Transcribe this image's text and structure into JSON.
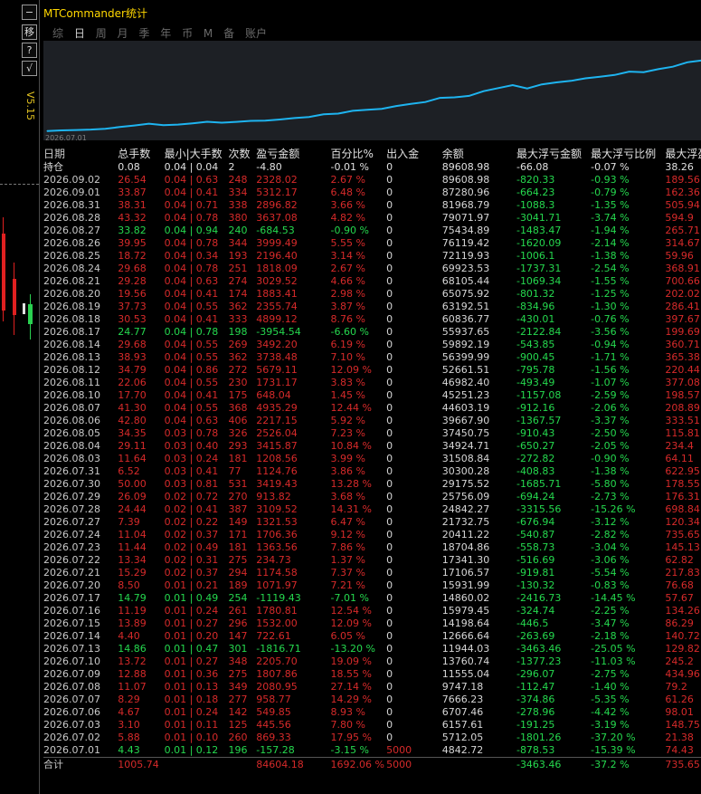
{
  "window": {
    "title": "MTCommander统计",
    "version": "V5.15"
  },
  "side_buttons": [
    "−",
    "移",
    "?",
    "√"
  ],
  "tabs": [
    {
      "label": "综",
      "active": false
    },
    {
      "label": "日",
      "active": true
    },
    {
      "label": "周",
      "active": false
    },
    {
      "label": "月",
      "active": false
    },
    {
      "label": "季",
      "active": false
    },
    {
      "label": "年",
      "active": false
    },
    {
      "label": "币",
      "active": false
    },
    {
      "label": "M",
      "active": false
    },
    {
      "label": "备",
      "active": false
    },
    {
      "label": "账户",
      "active": false
    }
  ],
  "chart_data": {
    "type": "line",
    "x_tick": "2026.07.01",
    "series_color": "#1eb4f0",
    "x": [
      "2026.07.01",
      "2026.07.02",
      "2026.07.03",
      "2026.07.06",
      "2026.07.07",
      "2026.07.08",
      "2026.07.09",
      "2026.07.10",
      "2026.07.13",
      "2026.07.14",
      "2026.07.15",
      "2026.07.16",
      "2026.07.17",
      "2026.07.20",
      "2026.07.21",
      "2026.07.22",
      "2026.07.23",
      "2026.07.24",
      "2026.07.27",
      "2026.07.28",
      "2026.07.29",
      "2026.07.30",
      "2026.07.31",
      "2026.08.03",
      "2026.08.04",
      "2026.08.05",
      "2026.08.06",
      "2026.08.07",
      "2026.08.10",
      "2026.08.11",
      "2026.08.12",
      "2026.08.13",
      "2026.08.14",
      "2026.08.17",
      "2026.08.18",
      "2026.08.19",
      "2026.08.20",
      "2026.08.21",
      "2026.08.24",
      "2026.08.25",
      "2026.08.26",
      "2026.08.27",
      "2026.08.28",
      "2026.08.31",
      "2026.09.01",
      "2026.09.02"
    ],
    "values": [
      4842.72,
      5712.05,
      6157.61,
      6707.46,
      7666.23,
      9747.18,
      11555.04,
      13760.74,
      11944.03,
      12666.64,
      14198.64,
      15979.45,
      14860.02,
      15931.99,
      17106.57,
      17341.3,
      18704.86,
      20411.22,
      21732.75,
      24842.27,
      25756.09,
      29175.52,
      30300.28,
      31508.84,
      34924.71,
      37450.75,
      39667.9,
      44603.19,
      45251.23,
      46982.4,
      52661.51,
      56399.99,
      59892.19,
      55937.65,
      60836.77,
      63192.51,
      65075.92,
      68105.44,
      69923.53,
      72119.93,
      76119.42,
      75434.89,
      79071.97,
      81968.79,
      87280.96,
      89608.98
    ]
  },
  "table": {
    "headers": [
      "日期",
      "总手数",
      "最小|大手数",
      "次数",
      "盈亏金额",
      "百分比%",
      "出入金",
      "余额",
      "最大浮亏金额",
      "最大浮亏比例",
      "最大浮盈金"
    ],
    "rows": [
      {
        "t": "hold",
        "c": [
          "持仓",
          "0.08",
          "0.04 | 0.04",
          "2",
          "-4.80",
          "-0.01 %",
          "0",
          "89608.98",
          "-66.08",
          "-0.07 %",
          "38.26"
        ]
      },
      {
        "t": "pos",
        "c": [
          "2026.09.02",
          "26.54",
          "0.04 | 0.63",
          "248",
          "2328.02",
          "2.67 %",
          "0",
          "89608.98",
          "-820.33",
          "-0.93 %",
          "189.56"
        ]
      },
      {
        "t": "pos",
        "c": [
          "2026.09.01",
          "33.87",
          "0.04 | 0.41",
          "334",
          "5312.17",
          "6.48 %",
          "0",
          "87280.96",
          "-664.23",
          "-0.79 %",
          "162.36"
        ]
      },
      {
        "t": "pos",
        "c": [
          "2026.08.31",
          "38.31",
          "0.04 | 0.71",
          "338",
          "2896.82",
          "3.66 %",
          "0",
          "81968.79",
          "-1088.3",
          "-1.35 %",
          "505.94"
        ]
      },
      {
        "t": "pos",
        "c": [
          "2026.08.28",
          "43.32",
          "0.04 | 0.78",
          "380",
          "3637.08",
          "4.82 %",
          "0",
          "79071.97",
          "-3041.71",
          "-3.74 %",
          "594.9"
        ]
      },
      {
        "t": "neg",
        "c": [
          "2026.08.27",
          "33.82",
          "0.04 | 0.94",
          "240",
          "-684.53",
          "-0.90 %",
          "0",
          "75434.89",
          "-1483.47",
          "-1.94 %",
          "265.71"
        ]
      },
      {
        "t": "pos",
        "c": [
          "2026.08.26",
          "39.95",
          "0.04 | 0.78",
          "344",
          "3999.49",
          "5.55 %",
          "0",
          "76119.42",
          "-1620.09",
          "-2.14 %",
          "314.67"
        ]
      },
      {
        "t": "pos",
        "c": [
          "2026.08.25",
          "18.72",
          "0.04 | 0.34",
          "193",
          "2196.40",
          "3.14 %",
          "0",
          "72119.93",
          "-1006.1",
          "-1.38 %",
          "59.96"
        ]
      },
      {
        "t": "pos",
        "c": [
          "2026.08.24",
          "29.68",
          "0.04 | 0.78",
          "251",
          "1818.09",
          "2.67 %",
          "0",
          "69923.53",
          "-1737.31",
          "-2.54 %",
          "368.91"
        ]
      },
      {
        "t": "pos",
        "c": [
          "2026.08.21",
          "29.28",
          "0.04 | 0.63",
          "274",
          "3029.52",
          "4.66 %",
          "0",
          "68105.44",
          "-1069.34",
          "-1.55 %",
          "700.66"
        ]
      },
      {
        "t": "pos",
        "c": [
          "2026.08.20",
          "19.56",
          "0.04 | 0.41",
          "174",
          "1883.41",
          "2.98 %",
          "0",
          "65075.92",
          "-801.32",
          "-1.25 %",
          "202.02"
        ]
      },
      {
        "t": "pos",
        "c": [
          "2026.08.19",
          "37.73",
          "0.04 | 0.55",
          "362",
          "2355.74",
          "3.87 %",
          "0",
          "63192.51",
          "-834.96",
          "-1.30 %",
          "286.41"
        ]
      },
      {
        "t": "pos",
        "c": [
          "2026.08.18",
          "30.53",
          "0.04 | 0.41",
          "333",
          "4899.12",
          "8.76 %",
          "0",
          "60836.77",
          "-430.01",
          "-0.76 %",
          "397.67"
        ]
      },
      {
        "t": "neg",
        "c": [
          "2026.08.17",
          "24.77",
          "0.04 | 0.78",
          "198",
          "-3954.54",
          "-6.60 %",
          "0",
          "55937.65",
          "-2122.84",
          "-3.56 %",
          "199.69"
        ]
      },
      {
        "t": "pos",
        "c": [
          "2026.08.14",
          "29.68",
          "0.04 | 0.55",
          "269",
          "3492.20",
          "6.19 %",
          "0",
          "59892.19",
          "-543.85",
          "-0.94 %",
          "360.71"
        ]
      },
      {
        "t": "pos",
        "c": [
          "2026.08.13",
          "38.93",
          "0.04 | 0.55",
          "362",
          "3738.48",
          "7.10 %",
          "0",
          "56399.99",
          "-900.45",
          "-1.71 %",
          "365.38"
        ]
      },
      {
        "t": "pos",
        "c": [
          "2026.08.12",
          "34.79",
          "0.04 | 0.86",
          "272",
          "5679.11",
          "12.09 %",
          "0",
          "52661.51",
          "-795.78",
          "-1.56 %",
          "220.44"
        ]
      },
      {
        "t": "pos",
        "c": [
          "2026.08.11",
          "22.06",
          "0.04 | 0.55",
          "230",
          "1731.17",
          "3.83 %",
          "0",
          "46982.40",
          "-493.49",
          "-1.07 %",
          "377.08"
        ]
      },
      {
        "t": "pos",
        "c": [
          "2026.08.10",
          "17.70",
          "0.04 | 0.41",
          "175",
          "648.04",
          "1.45 %",
          "0",
          "45251.23",
          "-1157.08",
          "-2.59 %",
          "198.57"
        ]
      },
      {
        "t": "pos",
        "c": [
          "2026.08.07",
          "41.30",
          "0.04 | 0.55",
          "368",
          "4935.29",
          "12.44 %",
          "0",
          "44603.19",
          "-912.16",
          "-2.06 %",
          "208.89"
        ]
      },
      {
        "t": "pos",
        "c": [
          "2026.08.06",
          "42.80",
          "0.04 | 0.63",
          "406",
          "2217.15",
          "5.92 %",
          "0",
          "39667.90",
          "-1367.57",
          "-3.37 %",
          "333.51"
        ]
      },
      {
        "t": "pos",
        "c": [
          "2026.08.05",
          "34.35",
          "0.03 | 0.78",
          "326",
          "2526.04",
          "7.23 %",
          "0",
          "37450.75",
          "-910.43",
          "-2.50 %",
          "115.81"
        ]
      },
      {
        "t": "pos",
        "c": [
          "2026.08.04",
          "29.11",
          "0.03 | 0.40",
          "293",
          "3415.87",
          "10.84 %",
          "0",
          "34924.71",
          "-650.27",
          "-2.05 %",
          "234.4"
        ]
      },
      {
        "t": "pos",
        "c": [
          "2026.08.03",
          "11.64",
          "0.03 | 0.24",
          "181",
          "1208.56",
          "3.99 %",
          "0",
          "31508.84",
          "-272.82",
          "-0.90 %",
          "64.11"
        ]
      },
      {
        "t": "pos",
        "c": [
          "2026.07.31",
          "6.52",
          "0.03 | 0.41",
          "77",
          "1124.76",
          "3.86 %",
          "0",
          "30300.28",
          "-408.83",
          "-1.38 %",
          "622.95"
        ]
      },
      {
        "t": "pos",
        "c": [
          "2026.07.30",
          "50.00",
          "0.03 | 0.81",
          "531",
          "3419.43",
          "13.28 %",
          "0",
          "29175.52",
          "-1685.71",
          "-5.80 %",
          "178.55"
        ]
      },
      {
        "t": "pos",
        "c": [
          "2026.07.29",
          "26.09",
          "0.02 | 0.72",
          "270",
          "913.82",
          "3.68 %",
          "0",
          "25756.09",
          "-694.24",
          "-2.73 %",
          "176.31"
        ]
      },
      {
        "t": "pos",
        "c": [
          "2026.07.28",
          "24.44",
          "0.02 | 0.41",
          "387",
          "3109.52",
          "14.31 %",
          "0",
          "24842.27",
          "-3315.56",
          "-15.26 %",
          "698.84"
        ]
      },
      {
        "t": "pos",
        "c": [
          "2026.07.27",
          "7.39",
          "0.02 | 0.22",
          "149",
          "1321.53",
          "6.47 %",
          "0",
          "21732.75",
          "-676.94",
          "-3.12 %",
          "120.34"
        ]
      },
      {
        "t": "pos",
        "c": [
          "2026.07.24",
          "11.04",
          "0.02 | 0.37",
          "171",
          "1706.36",
          "9.12 %",
          "0",
          "20411.22",
          "-540.87",
          "-2.82 %",
          "735.65"
        ]
      },
      {
        "t": "pos",
        "c": [
          "2026.07.23",
          "11.44",
          "0.02 | 0.49",
          "181",
          "1363.56",
          "7.86 %",
          "0",
          "18704.86",
          "-558.73",
          "-3.04 %",
          "145.13"
        ]
      },
      {
        "t": "pos",
        "c": [
          "2026.07.22",
          "13.34",
          "0.02 | 0.31",
          "275",
          "234.73",
          "1.37 %",
          "0",
          "17341.30",
          "-516.69",
          "-3.06 %",
          "62.82"
        ]
      },
      {
        "t": "pos",
        "c": [
          "2026.07.21",
          "15.29",
          "0.02 | 0.37",
          "294",
          "1174.58",
          "7.37 %",
          "0",
          "17106.57",
          "-919.81",
          "-5.54 %",
          "217.83"
        ]
      },
      {
        "t": "pos",
        "c": [
          "2026.07.20",
          "8.50",
          "0.01 | 0.21",
          "189",
          "1071.97",
          "7.21 %",
          "0",
          "15931.99",
          "-130.32",
          "-0.83 %",
          "76.68"
        ]
      },
      {
        "t": "neg",
        "c": [
          "2026.07.17",
          "14.79",
          "0.01 | 0.49",
          "254",
          "-1119.43",
          "-7.01 %",
          "0",
          "14860.02",
          "-2416.73",
          "-14.45 %",
          "57.67"
        ]
      },
      {
        "t": "pos",
        "c": [
          "2026.07.16",
          "11.19",
          "0.01 | 0.24",
          "261",
          "1780.81",
          "12.54 %",
          "0",
          "15979.45",
          "-324.74",
          "-2.25 %",
          "134.26"
        ]
      },
      {
        "t": "pos",
        "c": [
          "2026.07.15",
          "13.89",
          "0.01 | 0.27",
          "296",
          "1532.00",
          "12.09 %",
          "0",
          "14198.64",
          "-446.5",
          "-3.47 %",
          "86.29"
        ]
      },
      {
        "t": "pos",
        "c": [
          "2026.07.14",
          "4.40",
          "0.01 | 0.20",
          "147",
          "722.61",
          "6.05 %",
          "0",
          "12666.64",
          "-263.69",
          "-2.18 %",
          "140.72"
        ]
      },
      {
        "t": "neg",
        "c": [
          "2026.07.13",
          "14.86",
          "0.01 | 0.47",
          "301",
          "-1816.71",
          "-13.20 %",
          "0",
          "11944.03",
          "-3463.46",
          "-25.05 %",
          "129.82"
        ]
      },
      {
        "t": "pos",
        "c": [
          "2026.07.10",
          "13.72",
          "0.01 | 0.27",
          "348",
          "2205.70",
          "19.09 %",
          "0",
          "13760.74",
          "-1377.23",
          "-11.03 %",
          "245.2"
        ]
      },
      {
        "t": "pos",
        "c": [
          "2026.07.09",
          "12.88",
          "0.01 | 0.36",
          "275",
          "1807.86",
          "18.55 %",
          "0",
          "11555.04",
          "-296.07",
          "-2.75 %",
          "434.96"
        ]
      },
      {
        "t": "pos",
        "c": [
          "2026.07.08",
          "11.07",
          "0.01 | 0.13",
          "349",
          "2080.95",
          "27.14 %",
          "0",
          "9747.18",
          "-112.47",
          "-1.40 %",
          "79.2"
        ]
      },
      {
        "t": "pos",
        "c": [
          "2026.07.07",
          "8.29",
          "0.01 | 0.18",
          "277",
          "958.77",
          "14.29 %",
          "0",
          "7666.23",
          "-374.86",
          "-5.35 %",
          "61.26"
        ]
      },
      {
        "t": "pos",
        "c": [
          "2026.07.06",
          "4.67",
          "0.01 | 0.24",
          "142",
          "549.85",
          "8.93 %",
          "0",
          "6707.46",
          "-278.96",
          "-4.42 %",
          "98.01"
        ]
      },
      {
        "t": "pos",
        "c": [
          "2026.07.03",
          "3.10",
          "0.01 | 0.11",
          "125",
          "445.56",
          "7.80 %",
          "0",
          "6157.61",
          "-191.25",
          "-3.19 %",
          "148.75"
        ]
      },
      {
        "t": "pos",
        "c": [
          "2026.07.02",
          "5.88",
          "0.01 | 0.10",
          "260",
          "869.33",
          "17.95 %",
          "0",
          "5712.05",
          "-1801.26",
          "-37.20 %",
          "21.38"
        ]
      },
      {
        "t": "neg",
        "c": [
          "2026.07.01",
          "4.43",
          "0.01 | 0.12",
          "196",
          "-157.28",
          "-3.15 %",
          "5000",
          "4842.72",
          "-878.53",
          "-15.39 %",
          "74.43"
        ]
      }
    ],
    "total": [
      "合计",
      "1005.74",
      "",
      "",
      "84604.18",
      "1692.06 %",
      "5000",
      "",
      "-3463.46",
      "-37.2 %",
      "735.65"
    ]
  }
}
